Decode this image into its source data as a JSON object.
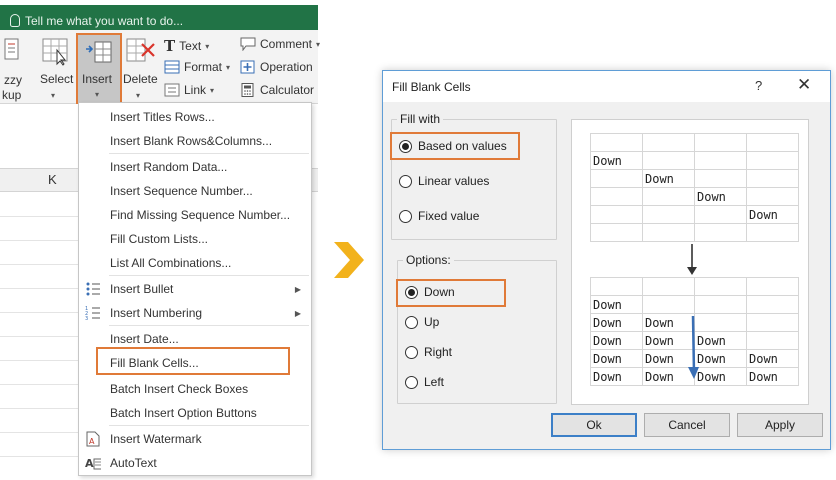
{
  "excel": {
    "tell_me_placeholder": "Tell me what you want to do...",
    "ribbon": {
      "fuzzy_label_line1": "zzy",
      "fuzzy_label_line2": "kup",
      "select_label": "Select",
      "insert_label": "Insert",
      "delete_label": "Delete",
      "text_label": "Text",
      "format_label": "Format",
      "link_label": "Link",
      "comment_label": "Comment",
      "operation_label": "Operation",
      "calculator_label": "Calculator"
    },
    "column_header": "K",
    "menu": {
      "items": [
        {
          "label": "Insert Titles Rows..."
        },
        {
          "label": "Insert Blank Rows&Columns..."
        },
        {
          "label": "Insert Random Data..."
        },
        {
          "label": "Insert Sequence Number..."
        },
        {
          "label": "Find Missing Sequence Number..."
        },
        {
          "label": "Fill Custom Lists..."
        },
        {
          "label": "List All Combinations..."
        },
        {
          "label": "Insert Bullet"
        },
        {
          "label": "Insert Numbering"
        },
        {
          "label": "Insert Date..."
        },
        {
          "label": "Fill Blank Cells..."
        },
        {
          "label": "Batch Insert Check Boxes"
        },
        {
          "label": "Batch Insert Option Buttons"
        },
        {
          "label": "Insert Watermark"
        },
        {
          "label": "AutoText"
        }
      ]
    }
  },
  "dialog": {
    "title": "Fill Blank Cells",
    "help": "?",
    "close": "✕",
    "fill_with": {
      "label": "Fill with",
      "options": [
        "Based on values",
        "Linear values",
        "Fixed value"
      ],
      "selected": "Based on values"
    },
    "options_group": {
      "label": "Options:",
      "options": [
        "Down",
        "Up",
        "Right",
        "Left"
      ],
      "selected": "Down"
    },
    "preview": {
      "before": [
        [
          "",
          "",
          "",
          ""
        ],
        [
          "Down",
          "",
          "",
          ""
        ],
        [
          "",
          "Down",
          "",
          ""
        ],
        [
          "",
          "",
          "Down",
          ""
        ],
        [
          "",
          "",
          "",
          "Down"
        ],
        [
          "",
          "",
          "",
          ""
        ]
      ],
      "after": [
        [
          "",
          "",
          "",
          ""
        ],
        [
          "Down",
          "",
          "",
          ""
        ],
        [
          "Down",
          "Down",
          "",
          ""
        ],
        [
          "Down",
          "Down",
          "Down",
          ""
        ],
        [
          "Down",
          "Down",
          "Down",
          "Down"
        ],
        [
          "Down",
          "Down",
          "Down",
          "Down"
        ]
      ]
    },
    "buttons": {
      "ok": "Ok",
      "cancel": "Cancel",
      "apply": "Apply"
    }
  },
  "colors": {
    "excel_green": "#217346",
    "highlight_orange": "#e07a38",
    "arrow_gold": "#f2b21c",
    "arrow_blue": "#3a6fb5"
  }
}
